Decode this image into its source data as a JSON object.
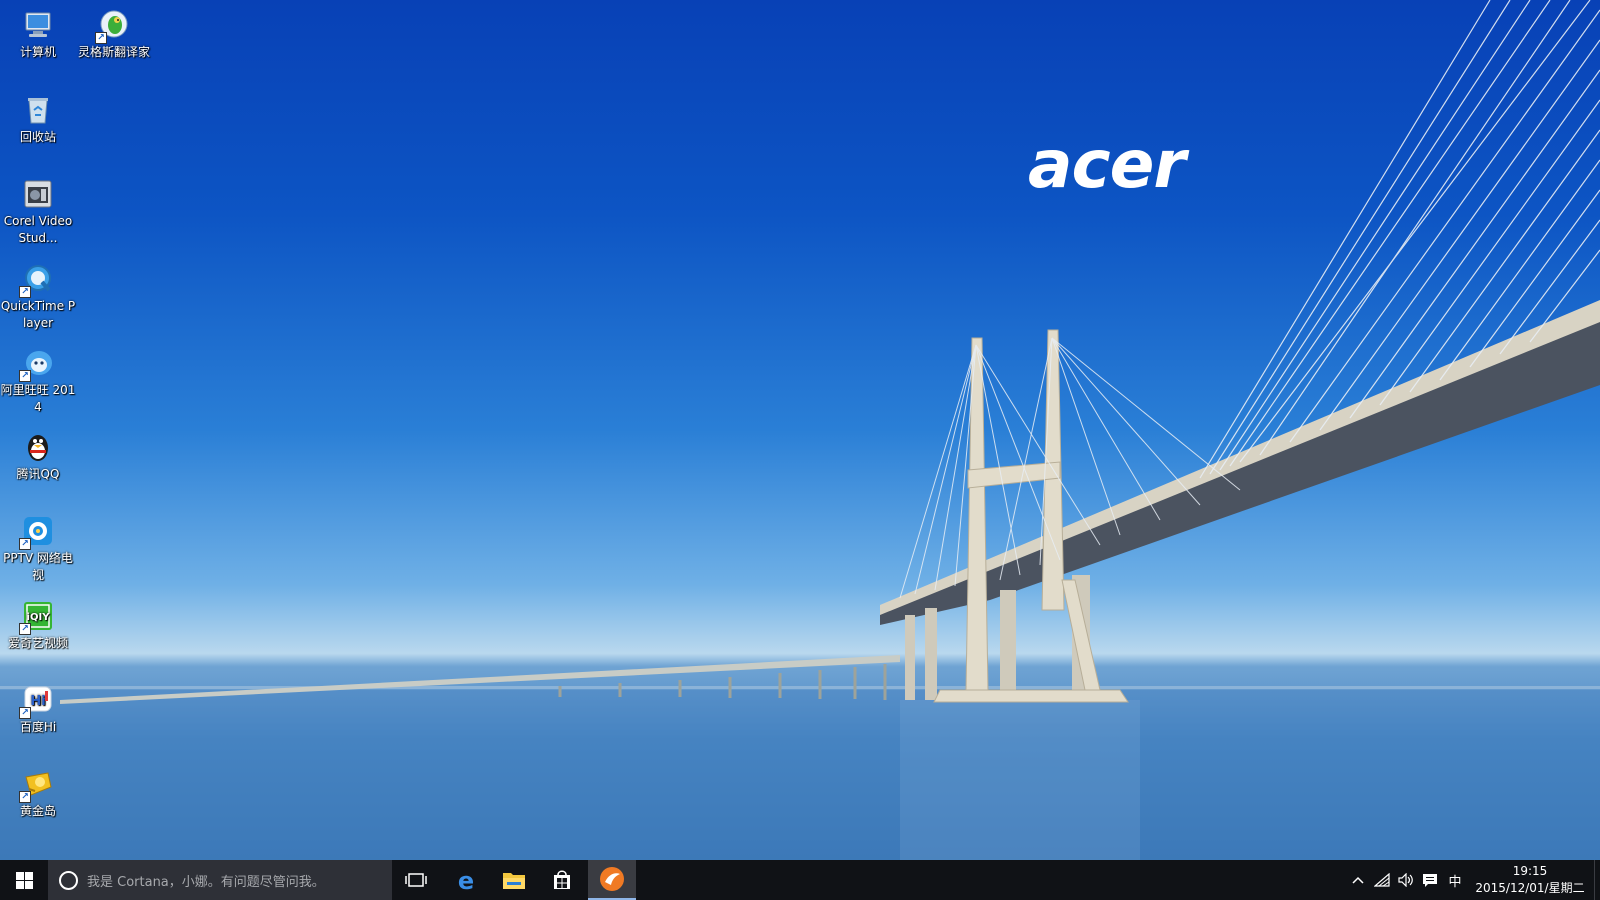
{
  "desktop": {
    "wallpaper_brand": "acer",
    "icons": [
      {
        "label": "计算机",
        "icon": "computer-icon",
        "shortcut": false
      },
      {
        "label": "灵格斯翻译家",
        "icon": "lingoes-parrot-icon",
        "shortcut": true
      },
      {
        "label": "回收站",
        "icon": "recycle-bin-icon",
        "shortcut": false
      },
      {
        "label": "Corel VideoStud...",
        "icon": "corel-videostudio-icon",
        "shortcut": false
      },
      {
        "label": "QuickTime Player",
        "icon": "quicktime-icon",
        "shortcut": true
      },
      {
        "label": "阿里旺旺 2014",
        "icon": "aliwangwang-icon",
        "shortcut": true
      },
      {
        "label": "腾讯QQ",
        "icon": "qq-penguin-icon",
        "shortcut": false
      },
      {
        "label": "PPTV 网络电视",
        "icon": "pptv-icon",
        "shortcut": true
      },
      {
        "label": "爱奇艺视频",
        "icon": "iqiyi-icon",
        "shortcut": true
      },
      {
        "label": "百度Hi",
        "icon": "baidu-hi-icon",
        "shortcut": true
      },
      {
        "label": "黄金岛",
        "icon": "huangjindao-icon",
        "shortcut": true
      }
    ]
  },
  "taskbar": {
    "search_placeholder": "我是 Cortana，小娜。有问题尽管问我。",
    "pinned": [
      {
        "name": "task-view-icon"
      },
      {
        "name": "edge-icon"
      },
      {
        "name": "file-explorer-icon"
      },
      {
        "name": "store-icon"
      },
      {
        "name": "active-app-icon",
        "active": true
      }
    ],
    "tray": {
      "ime_label": "中",
      "time": "19:15",
      "date": "2015/12/01/星期二"
    }
  },
  "colors": {
    "taskbar_bg": "#101216",
    "search_bg": "#2e3037",
    "sky_top": "#0841b6",
    "horizon": "#b9d8ee",
    "sea": "#3b78b6"
  }
}
